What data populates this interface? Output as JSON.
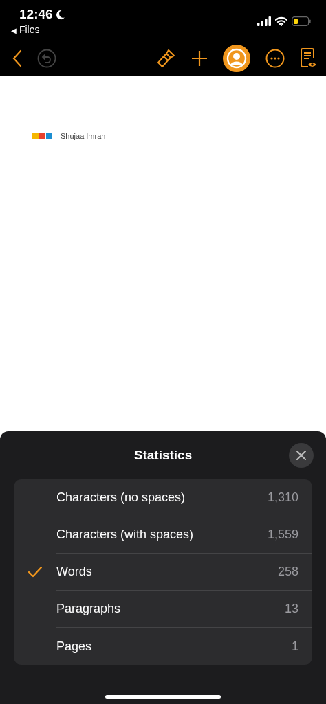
{
  "status_bar": {
    "time": "12:46",
    "back_arrow": "◀",
    "back_label": "Files"
  },
  "document": {
    "author": "Shujaa Imran"
  },
  "sheet": {
    "title": "Statistics",
    "rows": [
      {
        "label": "Characters (no spaces)",
        "value": "1,310",
        "selected": false
      },
      {
        "label": "Characters (with spaces)",
        "value": "1,559",
        "selected": false
      },
      {
        "label": "Words",
        "value": "258",
        "selected": true
      },
      {
        "label": "Paragraphs",
        "value": "13",
        "selected": false
      },
      {
        "label": "Pages",
        "value": "1",
        "selected": false
      }
    ]
  }
}
